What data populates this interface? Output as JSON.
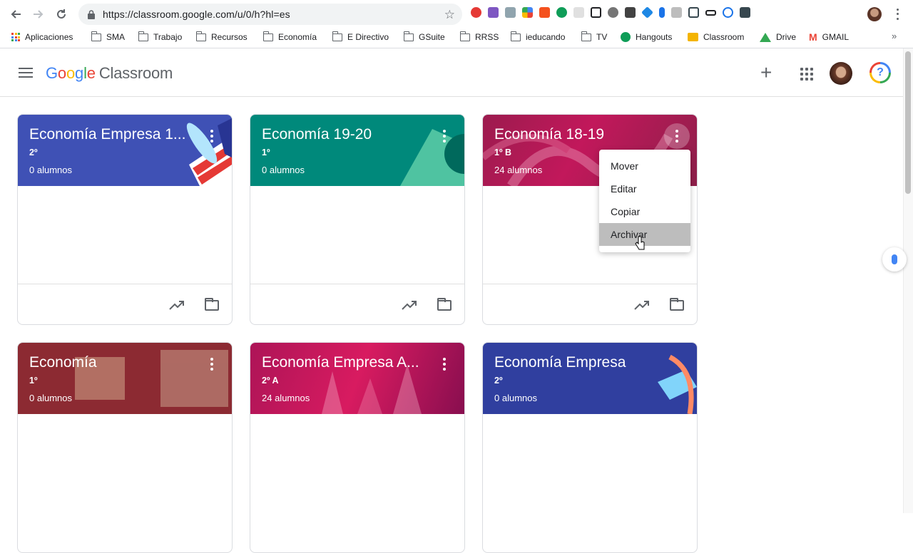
{
  "browser": {
    "url": "https://classroom.google.com/u/0/h?hl=es",
    "bookmarks": [
      "Aplicaciones",
      "SMA",
      "Trabajo",
      "Recursos",
      "Economía",
      "E Directivo",
      "GSuite",
      "RRSS",
      "ieducando",
      "TV",
      "Hangouts",
      "Classroom",
      "Drive",
      "GMAIL"
    ]
  },
  "header": {
    "logo_google": "Google",
    "logo_product": "Classroom",
    "help_label": "?"
  },
  "cards": [
    {
      "title": "Economía Empresa 1...",
      "section": "2º",
      "students": "0 alumnos",
      "color": "#3f51b5"
    },
    {
      "title": "Economía 19-20",
      "section": "1º",
      "students": "0 alumnos",
      "color": "#00897b"
    },
    {
      "title": "Economía 18-19",
      "section": "1º B",
      "students": "24 alumnos",
      "color": "#b0225a"
    },
    {
      "title": "Economía",
      "section": "1º",
      "students": "0 alumnos",
      "color": "#8c2a32"
    },
    {
      "title": "Economía Empresa A...",
      "section": "2º A",
      "students": "24 alumnos",
      "color": "#c2185b"
    },
    {
      "title": "Economía Empresa",
      "section": "2º",
      "students": "0 alumnos",
      "color": "#303f9f"
    }
  ],
  "context_menu": {
    "items": [
      "Mover",
      "Editar",
      "Copiar",
      "Archivar"
    ],
    "hovered": "Archivar"
  }
}
